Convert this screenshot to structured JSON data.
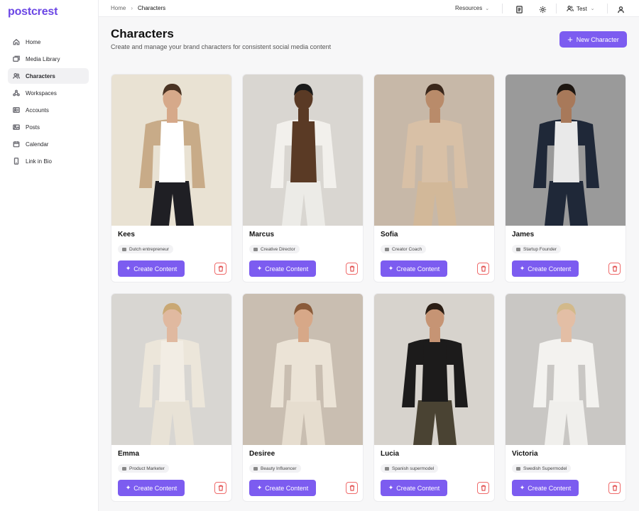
{
  "app": {
    "logo": "postcrest"
  },
  "colors": {
    "accent": "#7c5cf0",
    "danger": "#e04848"
  },
  "sidebar": {
    "items": [
      {
        "label": "Home",
        "icon": "home-icon"
      },
      {
        "label": "Media Library",
        "icon": "media-icon"
      },
      {
        "label": "Characters",
        "icon": "users-icon",
        "active": true
      },
      {
        "label": "Workspaces",
        "icon": "workspaces-icon"
      },
      {
        "label": "Accounts",
        "icon": "accounts-icon"
      },
      {
        "label": "Posts",
        "icon": "posts-icon"
      },
      {
        "label": "Calendar",
        "icon": "calendar-icon"
      },
      {
        "label": "Link in Bio",
        "icon": "phone-icon"
      }
    ]
  },
  "topbar": {
    "breadcrumb": {
      "home": "Home",
      "current": "Characters"
    },
    "resources": "Resources",
    "team": "Test"
  },
  "page": {
    "title": "Characters",
    "subtitle": "Create and manage your brand characters for consistent social media content",
    "new_button": "New Character"
  },
  "characters": [
    {
      "name": "Kees",
      "tag": "Dutch entrepreneur",
      "bg": "#e9e2d3",
      "top": "#c8ab88",
      "inner": "#ffffff",
      "pants": "#1f1f24",
      "skin": "#d6a98a",
      "hair": "#4a3323"
    },
    {
      "name": "Marcus",
      "tag": "Creative Director",
      "bg": "#d9d6d1",
      "top": "#f2f0ec",
      "inner": "#5a3a25",
      "pants": "#ecebe7",
      "skin": "#5a3a25",
      "hair": "#1a1a1a"
    },
    {
      "name": "Sofia",
      "tag": "Creator Coach",
      "bg": "#c7b8a8",
      "top": "#d8c0a6",
      "inner": "#d8c0a6",
      "pants": "#d2b899",
      "skin": "#b98b6a",
      "hair": "#3a271b"
    },
    {
      "name": "James",
      "tag": "Startup Founder",
      "bg": "#9a9a9a",
      "top": "#1f2838",
      "inner": "#e9e9e9",
      "pants": "#1f2838",
      "skin": "#a8795a",
      "hair": "#1d1611"
    },
    {
      "name": "Emma",
      "tag": "Product Marketer",
      "bg": "#d8d6d2",
      "top": "#ece6da",
      "inner": "#f2ede4",
      "pants": "#e8e2d6",
      "skin": "#e0b9a0",
      "hair": "#c9a874"
    },
    {
      "name": "Desiree",
      "tag": "Beauty Influencer",
      "bg": "#c9beb1",
      "top": "#ebe3d6",
      "inner": "#ebe3d6",
      "pants": "#e6ddcf",
      "skin": "#d7a888",
      "hair": "#8a5b3a"
    },
    {
      "name": "Lucia",
      "tag": "Spanish supermodel",
      "bg": "#d7d3cd",
      "top": "#1c1b1b",
      "inner": "#1c1b1b",
      "pants": "#4a4333",
      "skin": "#c69474",
      "hair": "#2a1d14"
    },
    {
      "name": "Victoria",
      "tag": "Swedish Supermodel",
      "bg": "#c9c7c4",
      "top": "#f3f2ef",
      "inner": "#f3f2ef",
      "pants": "#f0efec",
      "skin": "#e3bea5",
      "hair": "#d2b98a"
    }
  ],
  "card": {
    "create_label": "Create Content"
  }
}
